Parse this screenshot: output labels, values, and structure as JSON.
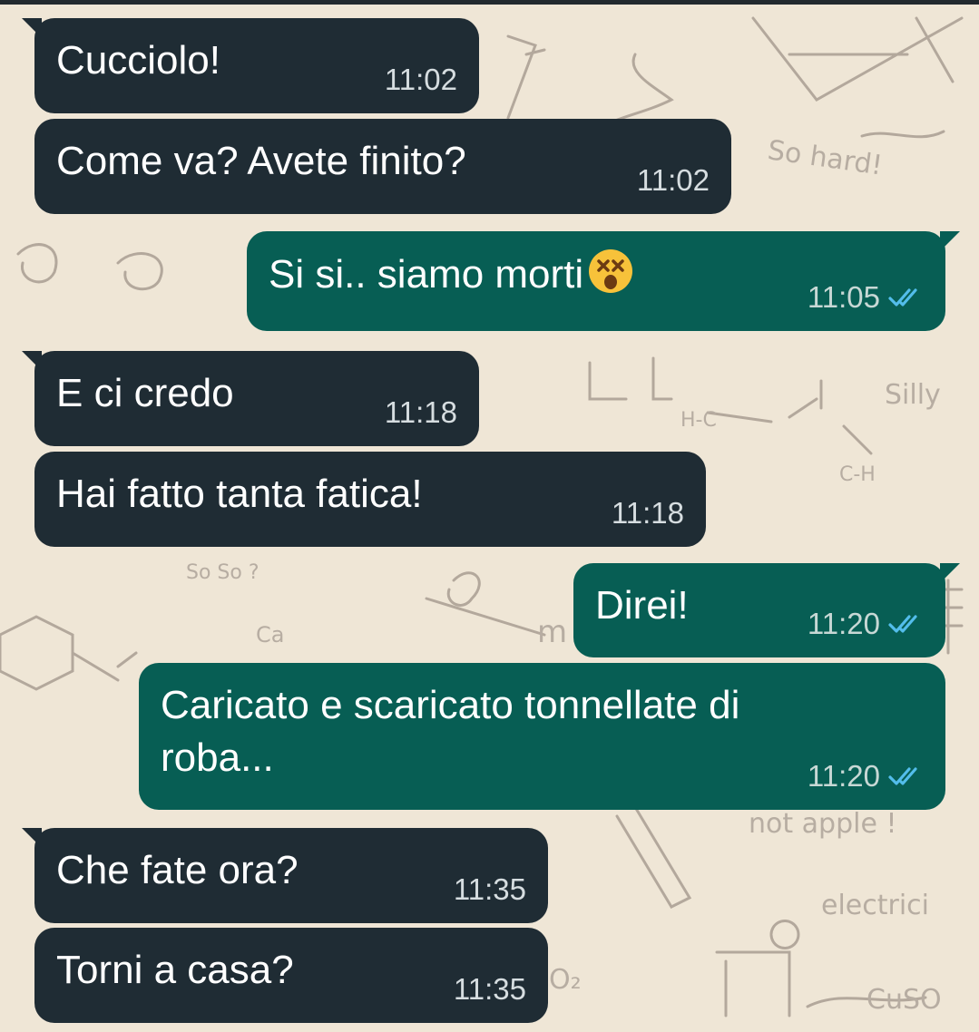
{
  "chat": {
    "colors": {
      "incoming_bubble": "#1f2c34",
      "outgoing_bubble": "#075e54",
      "read_ticks": "#53bdeb",
      "wallpaper": "#efe6d6"
    },
    "wallpaper_doodles": [
      "So hard!",
      "Silly",
      "So So ?",
      "not apple !",
      "electrici",
      "Ca",
      "CuSO",
      "O₂",
      "H-C",
      "C-H",
      "m"
    ],
    "messages": [
      {
        "direction": "incoming",
        "text": "Cucciolo!",
        "time": "11:02"
      },
      {
        "direction": "incoming",
        "text": "Come va? Avete finito?",
        "time": "11:02"
      },
      {
        "direction": "outgoing",
        "text": "Si si..  siamo morti",
        "emoji": "dizzy-face-emoji",
        "time": "11:05",
        "status": "read"
      },
      {
        "direction": "incoming",
        "text": "E ci credo",
        "time": "11:18"
      },
      {
        "direction": "incoming",
        "text": "Hai fatto tanta fatica!",
        "time": "11:18"
      },
      {
        "direction": "outgoing",
        "text": "Direi!",
        "time": "11:20",
        "status": "read"
      },
      {
        "direction": "outgoing",
        "text": "Caricato e scaricato tonnellate di roba...",
        "time": "11:20",
        "status": "read"
      },
      {
        "direction": "incoming",
        "text": "Che fate ora?",
        "time": "11:35"
      },
      {
        "direction": "incoming",
        "text": "Torni a casa?",
        "time": "11:35"
      }
    ]
  }
}
